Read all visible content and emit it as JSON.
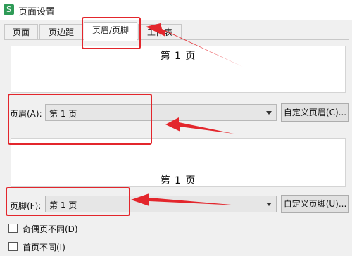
{
  "window": {
    "title": "页面设置",
    "app_icon_glyph": "S"
  },
  "tabs": [
    {
      "label": "页面"
    },
    {
      "label": "页边距"
    },
    {
      "label": "页眉/页脚",
      "active": true
    },
    {
      "label": "工作表"
    }
  ],
  "header": {
    "preview_text": "第 1 页",
    "label": "页眉(A):",
    "value": "第 1 页",
    "custom_button": "自定义页眉(C)..."
  },
  "footer": {
    "preview_text": "第 1 页",
    "label": "页脚(F):",
    "value": "第 1 页",
    "custom_button": "自定义页脚(U)..."
  },
  "options": [
    {
      "label": "奇偶页不同(D)",
      "checked": false
    },
    {
      "label": "首页不同(I)",
      "checked": false
    }
  ],
  "annotation": {
    "color": "#e3262c"
  }
}
